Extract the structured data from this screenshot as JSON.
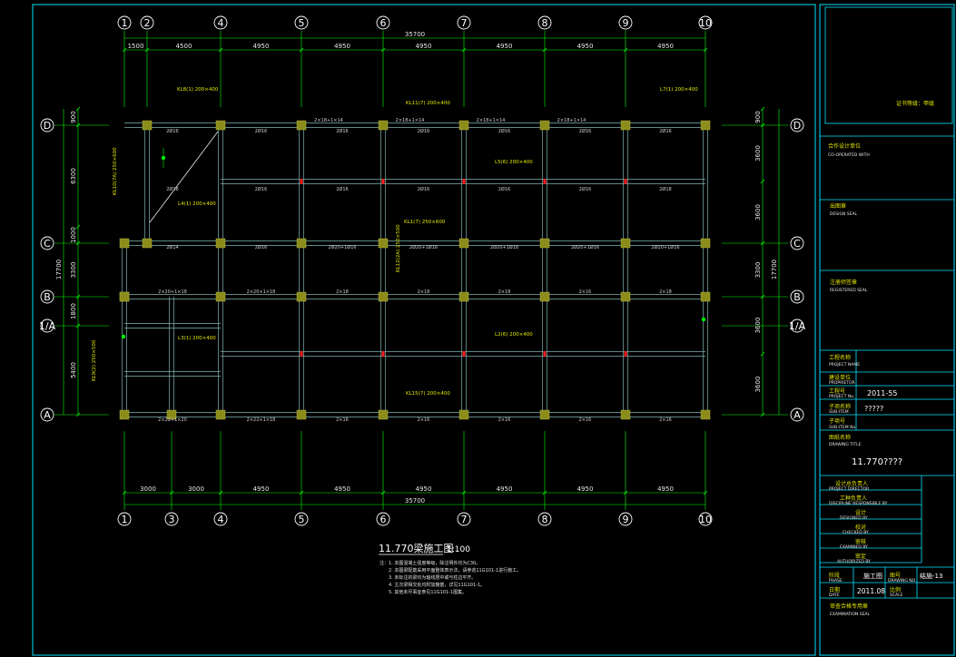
{
  "columns": [
    "1",
    "2",
    "4",
    "5",
    "6",
    "7",
    "8",
    "9",
    "10"
  ],
  "columns_bottom": [
    "1",
    "3",
    "4",
    "5",
    "6",
    "7",
    "8",
    "9",
    "10"
  ],
  "rows": [
    "D",
    "C",
    "B",
    "1/A",
    "A"
  ],
  "dims_top": {
    "overall": "35700",
    "spans": [
      "1500",
      "4500",
      "4950",
      "4950",
      "4950",
      "4950",
      "4950",
      "4950"
    ]
  },
  "dims_bottom": {
    "overall": "35700",
    "spans": [
      "3000",
      "3000",
      "4950",
      "4950",
      "4950",
      "4950",
      "4950",
      "4950"
    ]
  },
  "dims_left": {
    "overall": "17700",
    "parts": [
      "900",
      "6300",
      "1000",
      "3300",
      "1800",
      "5400"
    ]
  },
  "dims_right": {
    "overall": "17700",
    "parts": [
      "900",
      "3600",
      "3600",
      "3300",
      "3600",
      "3600"
    ]
  },
  "beam_labels": {
    "top_spans": [
      "2Ø16",
      "2Ø16",
      "2Ø16",
      "2Ø16",
      "2Ø16",
      "2Ø16",
      "2Ø16"
    ],
    "mid_spans": [
      "2Ø18",
      "2Ø16",
      "2Ø16",
      "2Ø16",
      "2Ø16",
      "2Ø16",
      "2Ø18"
    ],
    "c_spans": [
      "2Ø14",
      "2Ø16",
      "2Ø20+1Ø16",
      "2Ø20+1Ø16",
      "2Ø20+1Ø18",
      "2Ø20+1Ø16",
      "2Ø20+1Ø16"
    ],
    "b_spans": [
      "2×20+1×18",
      "2×20+1×18",
      "2×18",
      "2×18",
      "2×18",
      "2×16",
      "2×18"
    ],
    "a_spans": [
      "2×22+1×20",
      "2×22+1×18",
      "2×16",
      "2×16",
      "2×16",
      "2×16",
      "2×16"
    ],
    "d_corner": [
      "2×18+1×14",
      "2×18+1×14",
      "2×18+1×14",
      "2×18+1×14"
    ]
  },
  "yellow_labels": [
    "KL8(1) 200×400",
    "KL11(7) 200×400",
    "L7(1) 200×400",
    "L5(6) 200×400",
    "KL10(7A) 250×600",
    "L4(1) 200×400",
    "KL1(7) 250×600",
    "L2(6) 200×400",
    "KL15(7) 200×400",
    "KL12(2A) 250×500",
    "L3(1) 200×400",
    "KL9(2) 250×500"
  ],
  "drawing_title": "11.770梁施工图",
  "drawing_scale": "1:100",
  "notes": [
    "注：1. 本图混凝土强度等级，除注明外均为C30。",
    "2. 本图梁配筋采用平面整体表示法，请参逃11G101-1进行施工。",
    "3. 未标注的梁均为轴线居中或与柱边平齐。",
    "4. 主次梁相交处均附加箍筋，详见11G101-1。",
    "5. 其他未尽事宜参见11G101-1图集。"
  ],
  "title_block": {
    "cert_grade": "证书等级：甲级",
    "coop_cn": "合作设计单位",
    "coop_en": "CO-OPERATED WITH",
    "design_seal_cn": "出图章",
    "design_seal_en": "DESIGN SEAL",
    "reg_seal_cn": "注册师签章",
    "reg_seal_en": "REGISTERED SEAL",
    "project_name_cn": "工程名称",
    "project_name_en": "PROJECT NAME",
    "owner_cn": "建设单位",
    "owner_en": "PROPRIETOR",
    "project_no_cn": "工程号",
    "project_no_en": "PROJECT No.",
    "project_no": "2011-55",
    "subitem_cn": "子项名称",
    "subitem_en": "SUB-ITEM",
    "subitem": "?????",
    "subitem_no_cn": "子项号",
    "subitem_no_en": "SUB-ITEM No.",
    "drawing_title_cn": "图纸名称",
    "drawing_title_en": "DRAWING TITLE",
    "drawing_title": "11.770????",
    "director_cn": "设计总负责人",
    "director_en": "PROJECT DIRECTOR",
    "discipline_cn": "工种负责人",
    "discipline_en": "DISCIPLINE RESPONSIBLE BY",
    "designed_cn": "设计",
    "designed_en": "DESIGNED BY",
    "checked_cn": "校对",
    "checked_en": "CHECKED BY",
    "examined_cn": "审核",
    "examined_en": "EXAMINED BY",
    "authorized_cn": "审定",
    "authorized_en": "AUTHORIZED BY",
    "phase_cn": "阶段",
    "phase_en": "PHASE",
    "phase": "施工图",
    "drawing_no_cn": "图号",
    "drawing_no_en": "DRAWING NO.",
    "drawing_no": "结施-13",
    "date_cn": "日期",
    "date_en": "DATE",
    "date": "2011.08",
    "scale_cn": "比例",
    "scale_en": "SCALE",
    "exam_seal_cn": "审查合格专用章",
    "exam_seal_en": "EXAMINATION SEAL"
  },
  "colors": {
    "background": "#000000",
    "border": "#00e5ff",
    "grid": "#00ff00",
    "beam": "#7fb3b3",
    "column": "#8c8c1a",
    "yellow": "#e6e600",
    "red": "#ff2020"
  }
}
